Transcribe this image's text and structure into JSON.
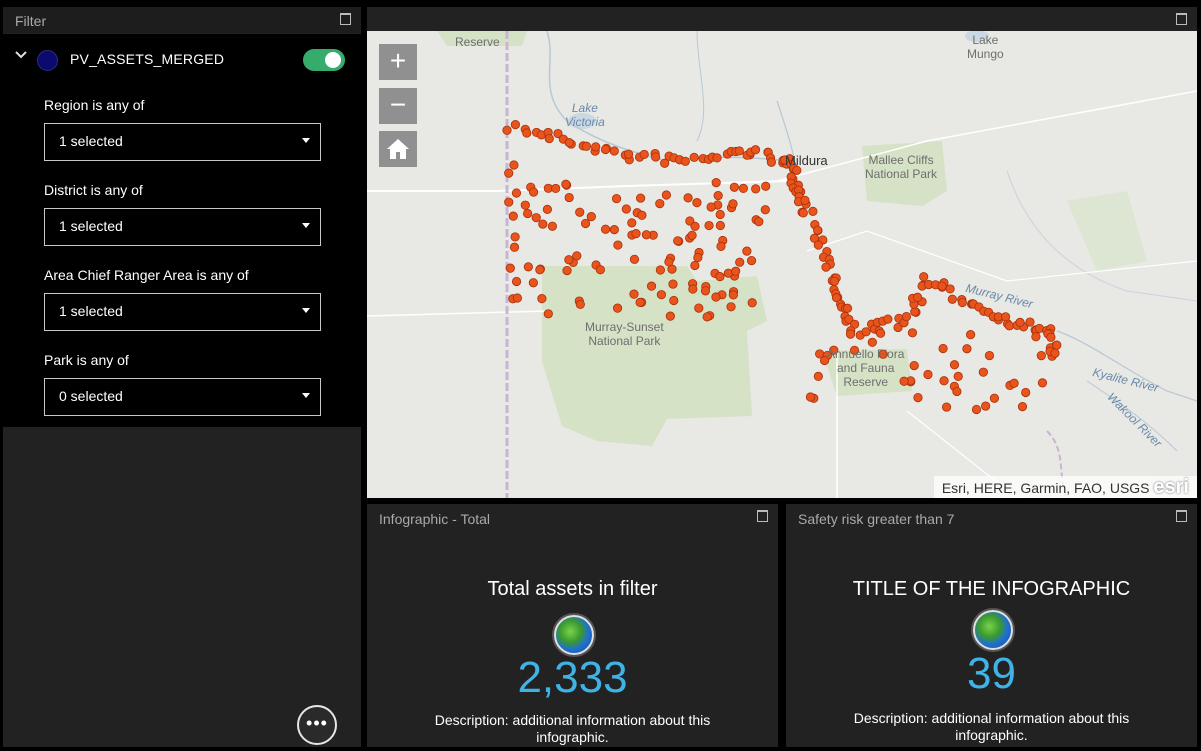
{
  "filter": {
    "title": "Filter",
    "layer_name": "PV_ASSETS_MERGED",
    "layer_enabled": true,
    "fields": [
      {
        "label": "Region is any of",
        "value": "1 selected"
      },
      {
        "label": "District is any of",
        "value": "1 selected"
      },
      {
        "label": "Area Chief Ranger Area is any of",
        "value": "1 selected"
      },
      {
        "label": "Park is any of",
        "value": "0 selected"
      }
    ],
    "more_label": "•••"
  },
  "map": {
    "zoom_in": "+",
    "zoom_out": "−",
    "attribution": "Esri, HERE, Garmin, FAO, USGS",
    "esri_logo": "esri",
    "labels": {
      "reserve_top": "Reserve",
      "lake_mungo": "Lake\nMungo",
      "lake_victoria": "Lake\nVictoria",
      "mildura": "Mildura",
      "mallee_cliffs": "Mallee Cliffs\nNational Park",
      "murray_sunset": "Murray-Sunset\nNational Park",
      "murray_river": "Murray River",
      "annuello": "Annuello Flora\nand Fauna\nReserve",
      "kyalite_river": "Kyalite River",
      "wakool_river": "Wakool River"
    },
    "point_color": "#e8541c"
  },
  "infographic_total": {
    "panel_title": "Infographic - Total",
    "title": "Total assets in filter",
    "value": "2,333",
    "description": "Description: additional information about this infographic."
  },
  "infographic_safety": {
    "panel_title": "Safety risk greater than 7",
    "title": "TITLE OF THE INFOGRAPHIC",
    "value": "39",
    "description": "Description: additional information about this infographic."
  }
}
